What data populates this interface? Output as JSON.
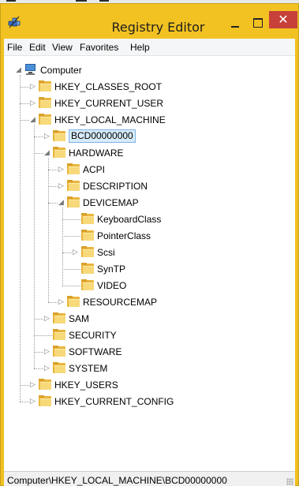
{
  "window": {
    "title": "Registry Editor",
    "close_glyph": "✕",
    "accent_color": "#f2c222",
    "close_color": "#c7403a"
  },
  "menu": [
    "File",
    "Edit",
    "View",
    "Favorites",
    "Help"
  ],
  "tree": [
    {
      "label": "Computer",
      "icon": "computer-icon",
      "depth": 0,
      "state": "expanded"
    },
    {
      "label": "HKEY_CLASSES_ROOT",
      "icon": "folder-icon",
      "depth": 1,
      "state": "collapsed"
    },
    {
      "label": "HKEY_CURRENT_USER",
      "icon": "folder-icon",
      "depth": 1,
      "state": "collapsed"
    },
    {
      "label": "HKEY_LOCAL_MACHINE",
      "icon": "folder-icon",
      "depth": 1,
      "state": "expanded"
    },
    {
      "label": "BCD00000000",
      "icon": "folder-icon",
      "depth": 2,
      "state": "collapsed",
      "selected": true
    },
    {
      "label": "HARDWARE",
      "icon": "folder-icon",
      "depth": 2,
      "state": "expanded"
    },
    {
      "label": "ACPI",
      "icon": "folder-icon",
      "depth": 3,
      "state": "collapsed"
    },
    {
      "label": "DESCRIPTION",
      "icon": "folder-icon",
      "depth": 3,
      "state": "collapsed"
    },
    {
      "label": "DEVICEMAP",
      "icon": "folder-icon",
      "depth": 3,
      "state": "expanded"
    },
    {
      "label": "KeyboardClass",
      "icon": "folder-icon",
      "depth": 4,
      "state": "leaf"
    },
    {
      "label": "PointerClass",
      "icon": "folder-icon",
      "depth": 4,
      "state": "leaf"
    },
    {
      "label": "Scsi",
      "icon": "folder-icon",
      "depth": 4,
      "state": "collapsed"
    },
    {
      "label": "SynTP",
      "icon": "folder-icon",
      "depth": 4,
      "state": "leaf"
    },
    {
      "label": "VIDEO",
      "icon": "folder-icon",
      "depth": 4,
      "state": "leaf"
    },
    {
      "label": "RESOURCEMAP",
      "icon": "folder-icon",
      "depth": 3,
      "state": "collapsed"
    },
    {
      "label": "SAM",
      "icon": "folder-icon",
      "depth": 2,
      "state": "collapsed"
    },
    {
      "label": "SECURITY",
      "icon": "folder-icon",
      "depth": 2,
      "state": "leaf"
    },
    {
      "label": "SOFTWARE",
      "icon": "folder-icon",
      "depth": 2,
      "state": "collapsed"
    },
    {
      "label": "SYSTEM",
      "icon": "folder-icon",
      "depth": 2,
      "state": "collapsed"
    },
    {
      "label": "HKEY_USERS",
      "icon": "folder-icon",
      "depth": 1,
      "state": "collapsed"
    },
    {
      "label": "HKEY_CURRENT_CONFIG",
      "icon": "folder-icon",
      "depth": 1,
      "state": "collapsed"
    }
  ],
  "status": {
    "path": "Computer\\HKEY_LOCAL_MACHINE\\BCD00000000"
  }
}
